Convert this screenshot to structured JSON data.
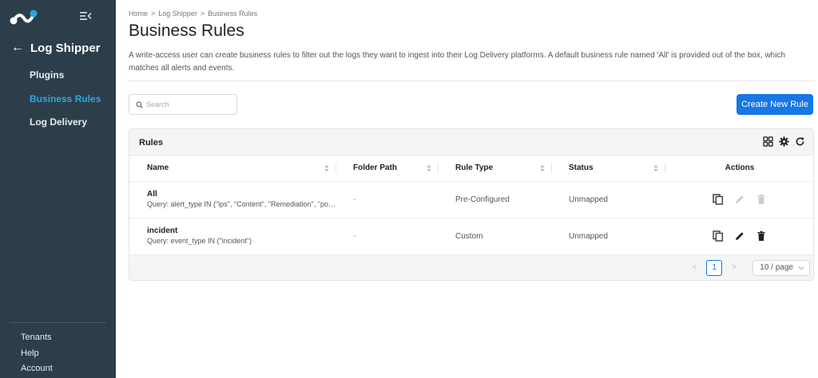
{
  "sidebar": {
    "back_label": "Log Shipper",
    "items": [
      {
        "label": "Plugins"
      },
      {
        "label": "Business Rules"
      },
      {
        "label": "Log Delivery"
      }
    ],
    "footer": [
      {
        "label": "Tenants"
      },
      {
        "label": "Help"
      },
      {
        "label": "Account"
      }
    ],
    "accent_color": "#2aa8e0"
  },
  "breadcrumb": [
    "Home",
    ">",
    "Log Shipper",
    ">",
    "Business Rules"
  ],
  "page": {
    "title": "Business Rules",
    "description": "A write-access user can create business rules to filter out the logs they want to ingest into their Log Delivery platforms. A default business rule named 'All' is provided out of the box, which matches all alerts and events."
  },
  "search": {
    "placeholder": "Search",
    "value": ""
  },
  "create_button": {
    "label": "Create New Rule",
    "color": "#1677e6"
  },
  "table": {
    "title": "Rules",
    "tool_icons": [
      "grid-icon",
      "gear-icon",
      "refresh-icon"
    ],
    "columns": [
      "Name",
      "Folder Path",
      "Rule Type",
      "Status",
      "Actions"
    ],
    "rows": [
      {
        "name": "All",
        "query": "Query: alert_type IN (\"ips\", \"Content\", \"Remediation\", \"pol...",
        "folder_path": "-",
        "rule_type": "Pre-Configured",
        "status": "Unmapped",
        "editable": false
      },
      {
        "name": "incident",
        "query": "Query: event_type IN (\"incident\")",
        "folder_path": "-",
        "rule_type": "Custom",
        "status": "Unmapped",
        "editable": true
      }
    ]
  },
  "pagination": {
    "prev": "<",
    "current_page": "1",
    "next": ">",
    "page_size": "10 / page"
  }
}
